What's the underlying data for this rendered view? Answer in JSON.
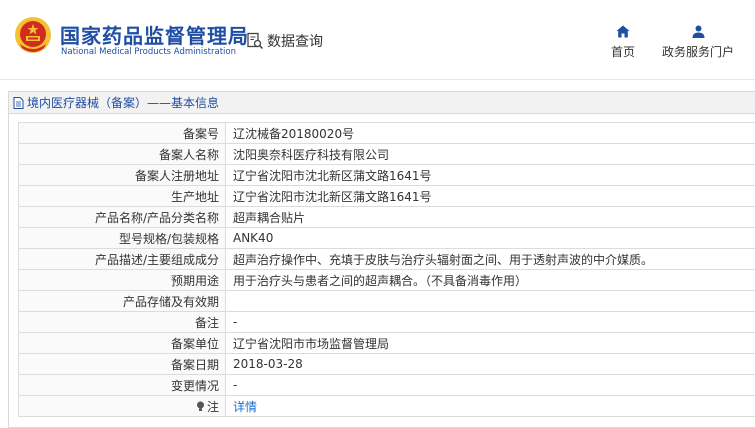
{
  "header": {
    "brand_cn": "国家药品监督管理局",
    "brand_en": "National Medical Products Administration",
    "query_label": "数据查询",
    "nav": [
      {
        "label": "首页",
        "icon": "home-icon"
      },
      {
        "label": "政务服务门户",
        "icon": "user-icon"
      }
    ]
  },
  "panel": {
    "title": "境内医疗器械（备案）——基本信息",
    "title_icon": "document-icon"
  },
  "rows": [
    {
      "key": "备案号",
      "value": "辽沈械备20180020号"
    },
    {
      "key": "备案人名称",
      "value": "沈阳奥奈科医疗科技有限公司"
    },
    {
      "key": "备案人注册地址",
      "value": "辽宁省沈阳市沈北新区蒲文路1641号"
    },
    {
      "key": "生产地址",
      "value": "辽宁省沈阳市沈北新区蒲文路1641号"
    },
    {
      "key": "产品名称/产品分类名称",
      "value": "超声耦合贴片"
    },
    {
      "key": "型号规格/包装规格",
      "value": "ANK40"
    },
    {
      "key": "产品描述/主要组成成分",
      "value": "超声治疗操作中、充填于皮肤与治疗头辐射面之间、用于透射声波的中介媒质。"
    },
    {
      "key": "预期用途",
      "value": "用于治疗头与患者之间的超声耦合。（不具备消毒作用）"
    },
    {
      "key": "产品存储及有效期",
      "value": ""
    },
    {
      "key": "备注",
      "value": "-"
    },
    {
      "key": "备案单位",
      "value": "辽宁省沈阳市市场监督管理局"
    },
    {
      "key": "备案日期",
      "value": "2018-03-28"
    },
    {
      "key": "变更情况",
      "value": "-"
    }
  ],
  "note_row": {
    "key": "注",
    "value": "详情",
    "icon": "lightbulb-icon"
  },
  "colors": {
    "brand_blue": "#1f4ea3",
    "link_blue": "#1f6fd0",
    "emblem_red": "#d42a1f",
    "emblem_gold": "#f2c230"
  }
}
